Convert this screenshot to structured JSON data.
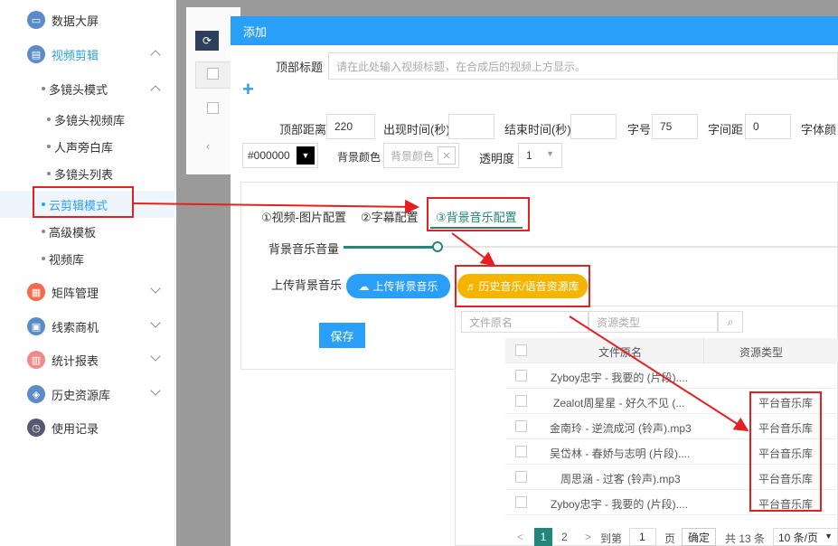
{
  "sidebar": {
    "items": [
      {
        "label": "数据大屏",
        "color": "#5b8cc9"
      },
      {
        "label": "视频剪辑",
        "color": "#5b8cc9"
      },
      {
        "label": "矩阵管理",
        "color": "#f36b4b"
      },
      {
        "label": "线索商机",
        "color": "#5b8cc9"
      },
      {
        "label": "统计报表",
        "color": "#f08a8a"
      },
      {
        "label": "历史资源库",
        "color": "#5b8cc9"
      },
      {
        "label": "使用记录",
        "color": "#555a6e"
      }
    ],
    "multi_camera": "多镜头模式",
    "subitems": [
      "多镜头视频库",
      "人声旁白库",
      "多镜头列表"
    ],
    "cloud_edit": "云剪辑模式",
    "advanced_template": "高级模板",
    "video_library": "视频库"
  },
  "dialog": {
    "title": "添加",
    "top_title_label": "顶部标题",
    "top_title_placeholder": "请在此处输入视频标题，在合成后的视频上方显示。",
    "plus_icon": "+",
    "top_distance_label": "顶部距离",
    "top_distance_value": "220",
    "appear_time_label": "出现时间(秒)",
    "end_time_label": "结束时间(秒)",
    "font_size_label": "字号",
    "font_size_value": "75",
    "letter_spacing_label": "字间距",
    "letter_spacing_value": "0",
    "font_color_label": "字体颜",
    "color_value": "#000000",
    "bg_color_label": "背景颜色",
    "bg_color_placeholder": "背景颜色",
    "opacity_label": "透明度",
    "opacity_value": "1",
    "tabs": [
      "①视频-图片配置",
      "②字幕配置",
      "③背景音乐配置"
    ],
    "volume_label": "背景音乐音量",
    "upload_label": "上传背景音乐",
    "upload_button": "上传背景音乐",
    "history_button": "历史音乐/语音资源库",
    "save_button": "保存",
    "search_filename_placeholder": "文件原名",
    "search_type_placeholder": "资源类型",
    "table": {
      "headers": [
        "文件原名",
        "资源类型"
      ],
      "rows": [
        [
          "Zyboy忠宇 - 我要的 (片段)....",
          ""
        ],
        [
          "Zealot周星星 - 好久不见 (...",
          "平台音乐库"
        ],
        [
          "金南玲 - 逆流成河 (铃声).mp3",
          "平台音乐库"
        ],
        [
          "吴岱林 - 春娇与志明 (片段)....",
          "平台音乐库"
        ],
        [
          "周思涵 - 过客 (铃声).mp3",
          "平台音乐库"
        ],
        [
          "Zyboy忠宇 - 我要的 (片段)....",
          "平台音乐库"
        ]
      ]
    },
    "pager": {
      "prev": "<",
      "page1": "1",
      "page2": "2",
      "next": ">",
      "goto": "到第",
      "goto_value": "1",
      "page_unit": "页",
      "confirm": "确定",
      "total": "共 13 条",
      "per_page": "10 条/页"
    }
  },
  "colors": {
    "primary": "#2a9ff7",
    "orange": "#f5b400",
    "teal": "#23867a",
    "red": "#e62020"
  }
}
